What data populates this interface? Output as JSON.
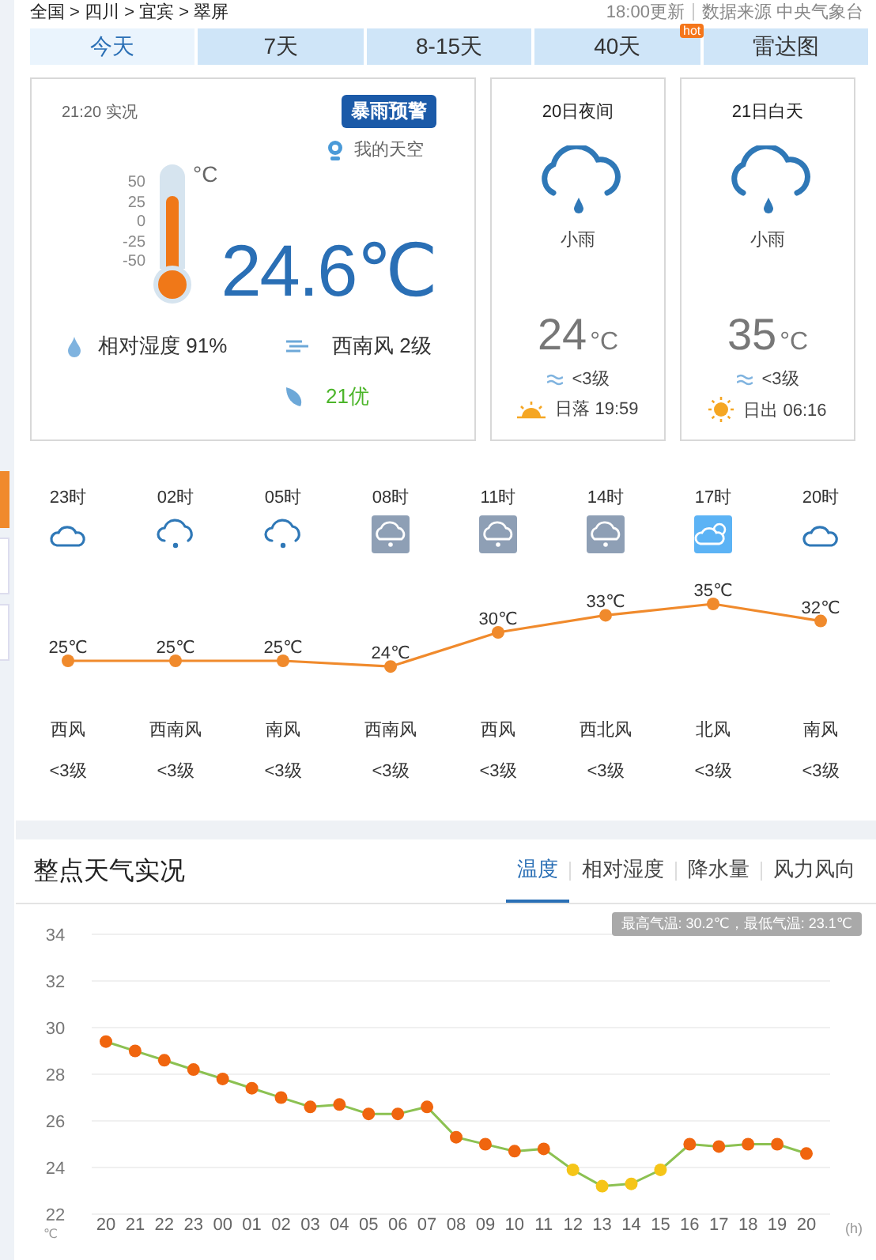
{
  "breadcrumb": {
    "path": "全国 > 四川 > 宜宾 > 翠屏",
    "update": "18:00更新",
    "source": "数据来源 中央气象台"
  },
  "side_tabs": [
    {
      "selected": true
    },
    {
      "selected": false
    },
    {
      "selected": false
    }
  ],
  "tabs": [
    {
      "label": "今天",
      "selected": true
    },
    {
      "label": "7天",
      "selected": false
    },
    {
      "label": "8-15天",
      "selected": false
    },
    {
      "label": "40天",
      "selected": false,
      "badge": "hot"
    },
    {
      "label": "雷达图",
      "selected": false
    }
  ],
  "current": {
    "time": "21:20 实况",
    "alert": "暴雨预警",
    "location": "我的天空",
    "scale": [
      "50",
      "25",
      "0",
      "-25",
      "-50"
    ],
    "scale_unit": "°C",
    "level": 0.75,
    "temperature": "24.6℃",
    "humidity": "相对湿度  91%",
    "wind": "西南风  2级",
    "air_quality": "21优"
  },
  "periods": [
    {
      "title": "20日夜间",
      "weather": "小雨",
      "temp": "24",
      "unit": "°C",
      "wind": "<3级",
      "kind": "sunset",
      "sun": "日落 19:59"
    },
    {
      "title": "21日白天",
      "weather": "小雨",
      "temp": "35",
      "unit": "°C",
      "wind": "<3级",
      "kind": "sunrise",
      "sun": "日出 06:16"
    }
  ],
  "hourly": {
    "items": [
      {
        "kind": "cloudy_night",
        "wind_dir": "西风",
        "wind_level": "<3级"
      },
      {
        "kind": "light_rain",
        "wind_dir": "西南风",
        "wind_level": "<3级"
      },
      {
        "kind": "light_rain",
        "wind_dir": "南风",
        "wind_level": "<3级"
      },
      {
        "kind": "rain_tile",
        "wind_dir": "西南风",
        "wind_level": "<3级"
      },
      {
        "kind": "rain_tile",
        "wind_dir": "西风",
        "wind_level": "<3级"
      },
      {
        "kind": "rain_tile",
        "wind_dir": "西北风",
        "wind_level": "<3级"
      },
      {
        "kind": "sun_cloud_tile",
        "wind_dir": "北风",
        "wind_level": "<3级"
      },
      {
        "kind": "cloudy_night",
        "wind_dir": "南风",
        "wind_level": "<3级"
      }
    ],
    "chart_data": {
      "type": "line",
      "categories": [
        "23时",
        "02时",
        "05时",
        "08时",
        "11时",
        "14时",
        "17时",
        "20时"
      ],
      "series": [
        {
          "color": "#f08a2c",
          "marker": "circle",
          "values": [
            25,
            25,
            25,
            24,
            30,
            33,
            35,
            32
          ],
          "value_labels": [
            "25℃",
            "25℃",
            "25℃",
            "24℃",
            "30℃",
            "33℃",
            "35℃",
            "32℃"
          ]
        }
      ]
    }
  },
  "observations": {
    "title": "整点天气实况",
    "tabs": [
      {
        "label": "温度",
        "selected": true
      },
      {
        "label": "相对湿度",
        "selected": false
      },
      {
        "label": "降水量",
        "selected": false
      },
      {
        "label": "风力风向",
        "selected": false
      }
    ],
    "summary": "最高气温: 30.2℃，最低气温: 23.1℃",
    "chart_data": {
      "type": "line",
      "ylabel": "℃",
      "xlabel": "(h)",
      "categories": [
        "20",
        "21",
        "22",
        "23",
        "00",
        "01",
        "02",
        "03",
        "04",
        "05",
        "06",
        "07",
        "08",
        "09",
        "10",
        "11",
        "12",
        "13",
        "14",
        "15",
        "16",
        "17",
        "18",
        "19",
        "20"
      ],
      "series": [
        {
          "color": "#8cc152",
          "marker": "circle",
          "values": [
            29.4,
            29.0,
            28.6,
            28.2,
            27.8,
            27.4,
            27.0,
            26.6,
            26.7,
            26.3,
            26.3,
            26.6,
            25.3,
            25.0,
            24.7,
            24.8,
            23.9,
            23.2,
            23.3,
            23.9,
            25.0,
            24.9,
            25.0,
            25.0,
            24.6
          ]
        }
      ],
      "ylim": [
        22,
        34
      ],
      "yticks": [
        22,
        24,
        26,
        28,
        30,
        32,
        34
      ],
      "grid": true
    }
  }
}
